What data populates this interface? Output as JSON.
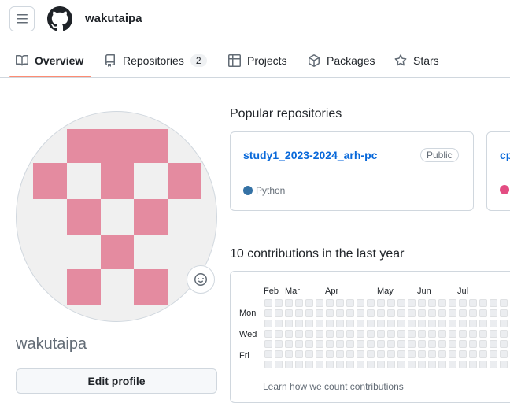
{
  "header": {
    "username": "wakutaipa",
    "menu_icon": "hamburger-icon",
    "logo_icon": "github-mark-icon"
  },
  "tabs": [
    {
      "label": "Overview",
      "icon": "book-icon",
      "active": true
    },
    {
      "label": "Repositories",
      "icon": "repo-icon",
      "count": "2"
    },
    {
      "label": "Projects",
      "icon": "table-icon"
    },
    {
      "label": "Packages",
      "icon": "package-icon"
    },
    {
      "label": "Stars",
      "icon": "star-icon"
    }
  ],
  "profile": {
    "name": "wakutaipa",
    "edit_button": "Edit profile",
    "status_icon": "smiley-icon"
  },
  "popular": {
    "title": "Popular repositories",
    "repos": [
      {
        "name": "study1_2023-2024_arh-pc",
        "visibility": "Public",
        "language": "Python",
        "language_color": "#3572A5"
      },
      {
        "name": "cp",
        "language_color": "#e34c82"
      }
    ]
  },
  "contributions": {
    "title": "10 contributions in the last year",
    "months": [
      "Feb",
      "Mar",
      "Apr",
      "May",
      "Jun",
      "Jul"
    ],
    "days": [
      "Mon",
      "Wed",
      "Fri"
    ],
    "learn_link": "Learn how we count contributions",
    "cell_color": "#ebedf0"
  },
  "colors": {
    "avatar_pink": "#e48ba0",
    "tab_underline": "#fd8c73",
    "link": "#0969da"
  }
}
